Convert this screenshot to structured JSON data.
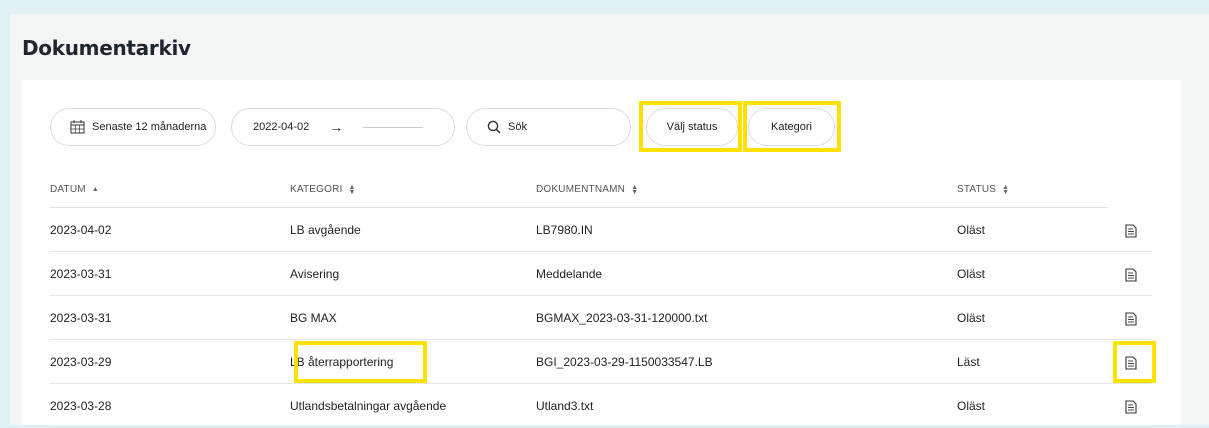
{
  "page": {
    "title": "Dokumentarkiv"
  },
  "filters": {
    "period_label": "Senaste 12 månaderna",
    "date_from": "2022-04-02",
    "date_arrow": "→",
    "search_placeholder": "Sök",
    "status_label": "Välj status",
    "category_label": "Kategori"
  },
  "table": {
    "columns": [
      "DATUM",
      "KATEGORI",
      "DOKUMENTNAMN",
      "STATUS"
    ],
    "rows": [
      {
        "date": "2023-04-02",
        "category": "LB avgående",
        "name": "LB7980.IN",
        "status": "Oläst",
        "icon": "document-icon"
      },
      {
        "date": "2023-03-31",
        "category": "Avisering",
        "name": "Meddelande",
        "status": "Oläst",
        "icon": "document-icon"
      },
      {
        "date": "2023-03-31",
        "category": "BG MAX",
        "name": "BGMAX_2023-03-31-120000.txt",
        "status": "Oläst",
        "icon": "document-icon"
      },
      {
        "date": "2023-03-29",
        "category": "LB återrapportering",
        "name": "BGI_2023-03-29-1150033547.LB",
        "status": "Läst",
        "icon": "document-icon"
      },
      {
        "date": "2023-03-28",
        "category": "Utlandsbetalningar avgående",
        "name": "Utland3.txt",
        "status": "Oläst",
        "icon": "document-icon"
      }
    ]
  },
  "colors": {
    "highlight": "#ffe100",
    "background": "#e0f1f4"
  }
}
